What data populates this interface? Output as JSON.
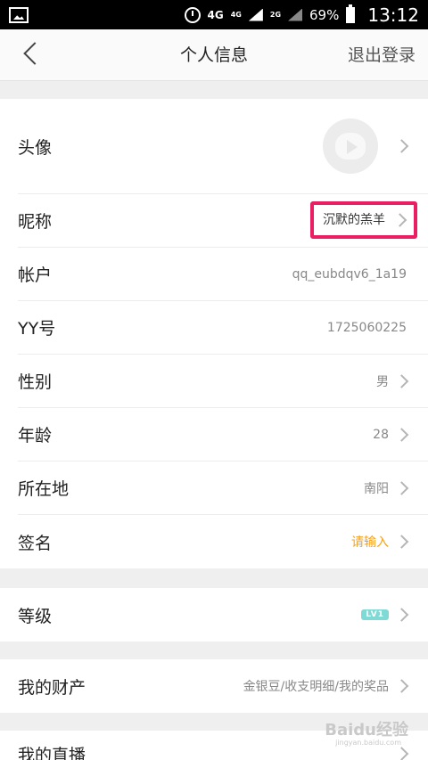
{
  "status_bar": {
    "network_primary": "4G",
    "network_secondary": "4G",
    "network_tertiary": "2G",
    "battery": "69%",
    "time": "13:12"
  },
  "header": {
    "title": "个人信息",
    "logout_label": "退出登录"
  },
  "profile": {
    "avatar_label": "头像",
    "nickname_label": "昵称",
    "nickname_value": "沉默的羔羊",
    "account_label": "帐户",
    "account_value": "qq_eubdqv6_1a19",
    "yy_label": "YY号",
    "yy_value": "1725060225",
    "gender_label": "性别",
    "gender_value": "男",
    "age_label": "年龄",
    "age_value": "28",
    "location_label": "所在地",
    "location_value": "南阳",
    "signature_label": "签名",
    "signature_value": "请输入"
  },
  "level": {
    "label": "等级",
    "badge": "LV1"
  },
  "assets": {
    "label": "我的财产",
    "value": "金银豆/收支明细/我的奖品"
  },
  "live": {
    "label": "我的直播"
  },
  "colors": {
    "highlight": "#e91e63",
    "signature_placeholder": "#f5a01a",
    "level_badge": "#7fd9d4"
  },
  "watermark": {
    "text": "Baidu经验",
    "sub": "jingyan.baidu.com"
  }
}
